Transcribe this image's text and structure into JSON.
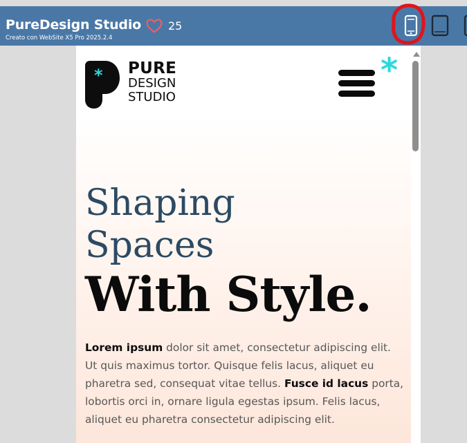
{
  "header": {
    "site_title": "PureDesign Studio",
    "subtitle": "Creato con WebSite X5 Pro 2025.2.4",
    "like_count": "25",
    "devices": [
      {
        "name": "phone",
        "icon": "phone-icon",
        "selected": true
      },
      {
        "name": "tablet",
        "icon": "tablet-icon",
        "selected": false
      },
      {
        "name": "desktop",
        "icon": "desktop-icon",
        "selected": false
      }
    ],
    "accent_color": "#4a78a6",
    "highlight_color": "#e0141c"
  },
  "site": {
    "logo": {
      "line1": "PURE",
      "line2": "DESIGN",
      "line3": "STUDIO"
    },
    "asterisk": "*",
    "headline_light": [
      "Shaping",
      "Spaces"
    ],
    "headline_bold": "With Style.",
    "paragraph": [
      {
        "bold": "Lorem ipsum",
        "text": " dolor sit amet, consectetur adipiscing elit. Ut quis maximus tortor. Quisque felis lacus, aliquet eu pharetra sed, consequat vitae tellus. "
      },
      {
        "bold": "Fusce id lacus",
        "text": " porta, lobortis orci in, ornare ligula egestas ipsum. Felis lacus, aliquet eu pharetra consectetur adipiscing elit."
      }
    ],
    "colors": {
      "teal": "#2ad9df",
      "headline": "#2c4a63"
    }
  }
}
